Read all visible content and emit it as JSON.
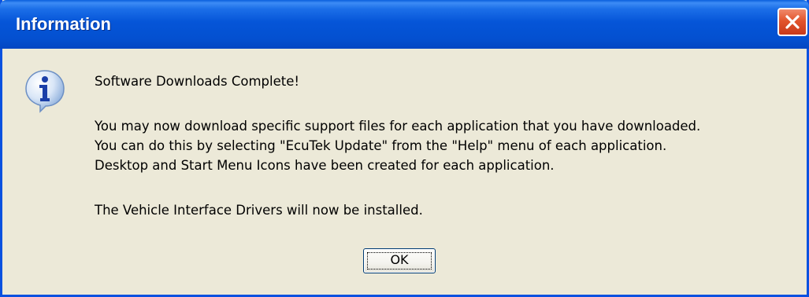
{
  "window": {
    "title": "Information",
    "close_icon": "close-icon"
  },
  "dialog": {
    "icon": "information-icon",
    "heading": "Software Downloads Complete!",
    "lines": [
      "You may now download specific support files for each application that you have downloaded.",
      "You can do this by selecting \"EcuTek Update\" from the \"Help\" menu of each application.",
      "Desktop and Start Menu Icons have been created for each application."
    ],
    "footer": "The Vehicle Interface Drivers will now be installed.",
    "ok_label": "OK"
  },
  "colors": {
    "titlebar": "#0555d8",
    "window_bg": "#ece9d8",
    "close_button": "#e2542c"
  }
}
